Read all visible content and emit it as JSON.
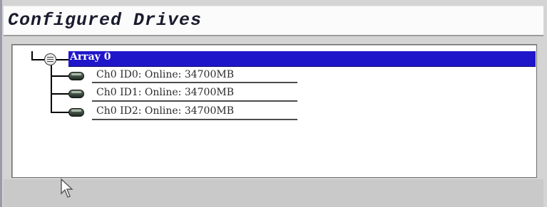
{
  "window": {
    "title": "Configured Drives"
  },
  "tree": {
    "root": {
      "label": "Array 0",
      "selected": true,
      "icon": "array-icon"
    },
    "drives": [
      {
        "label": "Ch0  ID0: Online: 34700MB",
        "icon": "disk-icon"
      },
      {
        "label": "Ch0  ID1: Online: 34700MB",
        "icon": "disk-icon"
      },
      {
        "label": "Ch0  ID2: Online: 34700MB",
        "icon": "disk-icon"
      }
    ]
  },
  "colors": {
    "selection": "#1f16ca",
    "panel_background": "#ffffff",
    "chrome": "#d4d4d4"
  }
}
